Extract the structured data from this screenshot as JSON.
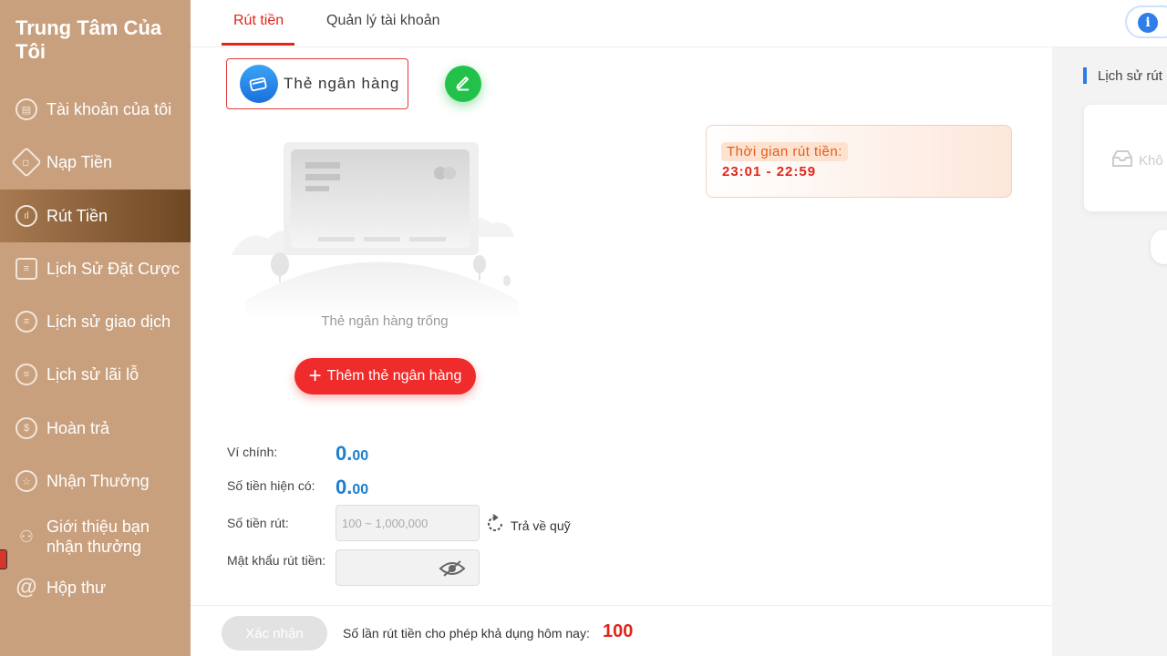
{
  "sidebar": {
    "title": "Trung Tâm Của Tôi",
    "items": [
      {
        "label": "Tài khoản của tôi",
        "icon": "account-icon"
      },
      {
        "label": "Nạp Tiền",
        "icon": "deposit-icon"
      },
      {
        "label": "Rút Tiền",
        "icon": "withdraw-icon",
        "active": true
      },
      {
        "label": "Lịch Sử Đặt Cược",
        "icon": "clipboard-icon"
      },
      {
        "label": "Lịch sử giao dịch",
        "icon": "transactions-icon"
      },
      {
        "label": "Lịch sử lãi lỗ",
        "icon": "profit-loss-icon"
      },
      {
        "label": "Hoàn trả",
        "icon": "rebate-icon"
      },
      {
        "label": "Nhận Thưởng",
        "icon": "reward-icon"
      },
      {
        "label": "Giới thiệu bạn nhận thưởng",
        "icon": "referral-icon"
      },
      {
        "label": "Hộp thư",
        "icon": "mail-icon"
      }
    ]
  },
  "tabs": [
    {
      "label": "Rút tiền",
      "active": true
    },
    {
      "label": "Quản lý tài khoản"
    }
  ],
  "card_type": {
    "label": "Thẻ ngân hàng"
  },
  "withdraw_time": {
    "title": "Thời gian rút tiền:",
    "value": "23:01  - 22:59"
  },
  "empty_state": {
    "text": "Thẻ ngân hàng trống",
    "add_button": "Thêm thẻ ngân hàng"
  },
  "form": {
    "main_wallet_label": "Ví chính:",
    "main_wallet_int": "0.",
    "main_wallet_dec": "00",
    "available_label": "Số tiền hiện có:",
    "available_int": "0.",
    "available_dec": "00",
    "amount_label": "Số tiền rút:",
    "amount_placeholder": "100 ~ 1,000,000",
    "refund_label": "Trả về quỹ",
    "password_label": "Mật khẩu rút tiền:"
  },
  "footer": {
    "confirm_button": "Xác nhận",
    "allowed_text": "Số lần rút tiền cho phép khả dụng hôm nay:",
    "allowed_count": "100"
  },
  "right_panel": {
    "title": "Lịch sử rút",
    "empty_text": "Khô"
  },
  "colors": {
    "accent": "#e1251b",
    "sidebar": "#c8a07e",
    "amount_blue": "#1a7fd0"
  }
}
